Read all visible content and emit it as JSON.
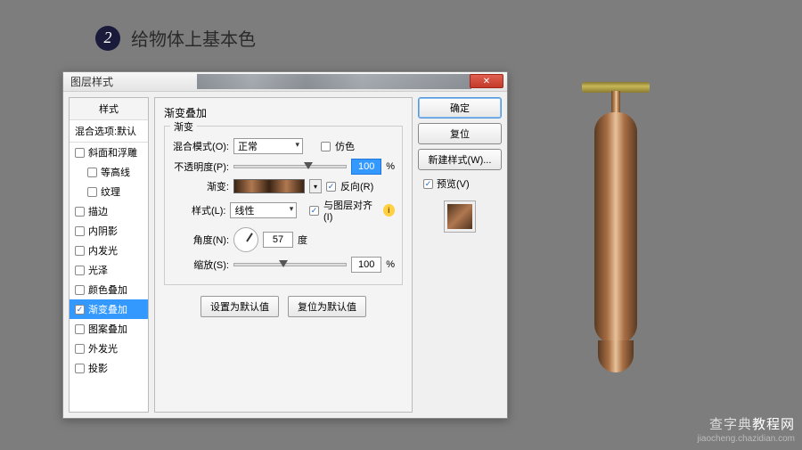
{
  "step": {
    "num": "2",
    "title": "给物体上基本色"
  },
  "dialog": {
    "title": "图层样式",
    "styles_header": "样式",
    "styles_sub": "混合选项:默认",
    "effects": [
      {
        "label": "斜面和浮雕",
        "checked": false,
        "indent": false
      },
      {
        "label": "等高线",
        "checked": false,
        "indent": true
      },
      {
        "label": "纹理",
        "checked": false,
        "indent": true
      },
      {
        "label": "描边",
        "checked": false,
        "indent": false
      },
      {
        "label": "内阴影",
        "checked": false,
        "indent": false
      },
      {
        "label": "内发光",
        "checked": false,
        "indent": false
      },
      {
        "label": "光泽",
        "checked": false,
        "indent": false
      },
      {
        "label": "颜色叠加",
        "checked": false,
        "indent": false
      },
      {
        "label": "渐变叠加",
        "checked": true,
        "indent": false,
        "selected": true
      },
      {
        "label": "图案叠加",
        "checked": false,
        "indent": false
      },
      {
        "label": "外发光",
        "checked": false,
        "indent": false
      },
      {
        "label": "投影",
        "checked": false,
        "indent": false
      }
    ],
    "panel_title": "渐变叠加",
    "fieldset_legend": "渐变",
    "blend_label": "混合模式(O):",
    "blend_value": "正常",
    "dither_label": "仿色",
    "opacity_label": "不透明度(P):",
    "opacity_value": "100",
    "gradient_label": "渐变:",
    "reverse_label": "反向(R)",
    "style_label": "样式(L):",
    "style_value": "线性",
    "align_label": "与图层对齐(I)",
    "angle_label": "角度(N):",
    "angle_value": "57",
    "angle_unit": "度",
    "scale_label": "缩放(S):",
    "scale_value": "100",
    "percent": "%",
    "default_set": "设置为默认值",
    "default_reset": "复位为默认值",
    "btn_ok": "确定",
    "btn_reset": "复位",
    "btn_newstyle": "新建样式(W)...",
    "preview_label": "预览(V)"
  },
  "watermark": {
    "cn_a": "查字典",
    "cn_b": "教程网",
    "en": "jiaocheng.chazidian.com"
  }
}
